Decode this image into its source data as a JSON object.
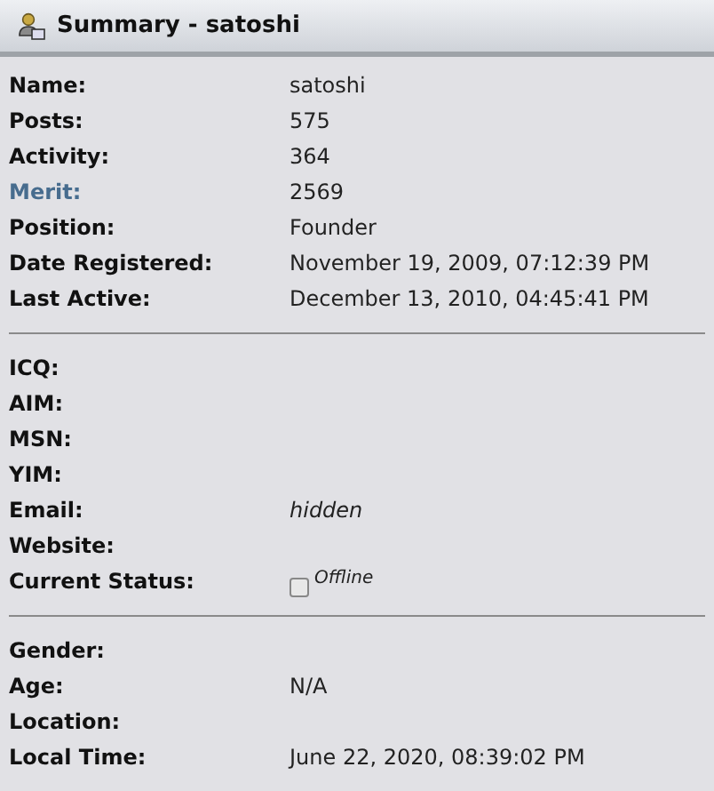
{
  "header": {
    "title": "Summary - satoshi"
  },
  "sections": [
    {
      "rows": [
        {
          "kind": "plain",
          "label": "Name:",
          "value": "satoshi"
        },
        {
          "kind": "plain",
          "label": "Posts:",
          "value": "575"
        },
        {
          "kind": "plain",
          "label": "Activity:",
          "value": "364"
        },
        {
          "kind": "link",
          "label": "Merit:",
          "value": "2569"
        },
        {
          "kind": "plain",
          "label": "Position:",
          "value": "Founder"
        },
        {
          "kind": "plain",
          "label": "Date Registered:",
          "value": "November 19, 2009, 07:12:39 PM"
        },
        {
          "kind": "plain",
          "label": "Last Active:",
          "value": "December 13, 2010, 04:45:41 PM"
        }
      ]
    },
    {
      "rows": [
        {
          "kind": "plain",
          "label": "ICQ:"
        },
        {
          "kind": "plain",
          "label": "AIM:"
        },
        {
          "kind": "plain",
          "label": "MSN:"
        },
        {
          "kind": "plain",
          "label": "YIM:"
        },
        {
          "kind": "italic",
          "label": "Email:",
          "value": "hidden"
        },
        {
          "kind": "plain",
          "label": "Website:"
        },
        {
          "kind": "status",
          "label": "Current Status:",
          "value": "Offline"
        }
      ]
    },
    {
      "rows": [
        {
          "kind": "plain",
          "label": "Gender:"
        },
        {
          "kind": "plain",
          "label": "Age:",
          "value": "N/A"
        },
        {
          "kind": "plain",
          "label": "Location:"
        },
        {
          "kind": "plain",
          "label": "Local Time:",
          "value": "June 22, 2020, 08:39:02 PM"
        }
      ]
    }
  ]
}
